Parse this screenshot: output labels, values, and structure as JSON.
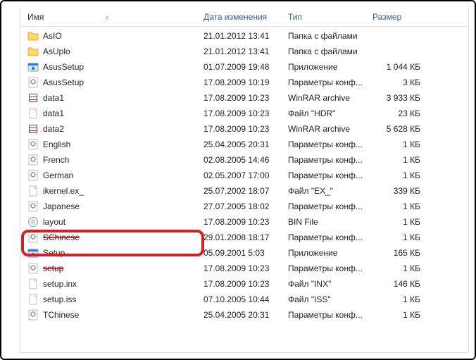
{
  "headers": {
    "name": "Имя",
    "date": "Дата изменения",
    "type": "Тип",
    "size": "Размер"
  },
  "rows": [
    {
      "icon": "folder",
      "name": "AsIO",
      "date": "21.01.2012 13:41",
      "type": "Папка с файлами",
      "size": ""
    },
    {
      "icon": "folder",
      "name": "AsUplo",
      "date": "21.01.2012 13:41",
      "type": "Папка с файлами",
      "size": ""
    },
    {
      "icon": "installer",
      "name": "AsusSetup",
      "date": "01.07.2009 19:48",
      "type": "Приложение",
      "size": "1 044 КБ"
    },
    {
      "icon": "config",
      "name": "AsusSetup",
      "date": "17.08.2009 10:19",
      "type": "Параметры конф...",
      "size": "3 КБ"
    },
    {
      "icon": "archive",
      "name": "data1",
      "date": "17.08.2009 10:23",
      "type": "WinRAR archive",
      "size": "3 933 КБ"
    },
    {
      "icon": "file",
      "name": "data1",
      "date": "17.08.2009 10:23",
      "type": "Файл \"HDR\"",
      "size": "23 КБ"
    },
    {
      "icon": "archive",
      "name": "data2",
      "date": "17.08.2009 10:23",
      "type": "WinRAR archive",
      "size": "5 628 КБ"
    },
    {
      "icon": "config",
      "name": "English",
      "date": "25.04.2005 20:31",
      "type": "Параметры конф...",
      "size": "1 КБ"
    },
    {
      "icon": "config",
      "name": "French",
      "date": "02.08.2005 14:46",
      "type": "Параметры конф...",
      "size": "1 КБ"
    },
    {
      "icon": "config",
      "name": "German",
      "date": "02.05.2007 17:00",
      "type": "Параметры конф...",
      "size": "1 КБ"
    },
    {
      "icon": "file",
      "name": "ikernel.ex_",
      "date": "25.07.2002 18:07",
      "type": "Файл \"EX_\"",
      "size": "339 КБ"
    },
    {
      "icon": "config",
      "name": "Japanese",
      "date": "27.07.2005 18:02",
      "type": "Параметры конф...",
      "size": "1 КБ"
    },
    {
      "icon": "disc",
      "name": "layout",
      "date": "17.08.2009 10:23",
      "type": "BIN File",
      "size": "1 КБ"
    },
    {
      "icon": "config",
      "name": "SChinese",
      "date": "29.01.2008 18:17",
      "type": "Параметры конф...",
      "size": "1 КБ",
      "strike": true
    },
    {
      "icon": "installer",
      "name": "Setup",
      "date": "05.09.2001 5:03",
      "type": "Приложение",
      "size": "165 КБ",
      "highlighted": true
    },
    {
      "icon": "config",
      "name": "setup",
      "date": "17.08.2009 10:23",
      "type": "Параметры конф...",
      "size": "1 КБ",
      "strike": true
    },
    {
      "icon": "file",
      "name": "setup.inx",
      "date": "17.08.2009 10:23",
      "type": "Файл \"INX\"",
      "size": "146 КБ"
    },
    {
      "icon": "file",
      "name": "setup.iss",
      "date": "07.10.2005 10:44",
      "type": "Файл \"ISS\"",
      "size": "1 КБ"
    },
    {
      "icon": "config",
      "name": "TChinese",
      "date": "25.04.2005 20:31",
      "type": "Параметры конф...",
      "size": "1 КБ"
    }
  ]
}
